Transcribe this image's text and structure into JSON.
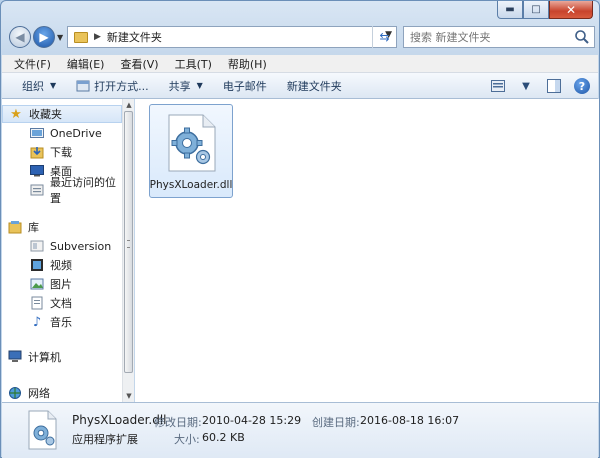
{
  "window": {
    "caption_buttons": {
      "minimize": "▬",
      "maximize": "□",
      "close": "✕"
    }
  },
  "address_bar": {
    "path": "新建文件夹",
    "search_placeholder": "搜索 新建文件夹"
  },
  "menu": [
    "文件(F)",
    "编辑(E)",
    "查看(V)",
    "工具(T)",
    "帮助(H)"
  ],
  "toolbar": {
    "organize": "组织",
    "open_with": "打开方式...",
    "share": "共享",
    "email": "电子邮件",
    "new_folder": "新建文件夹"
  },
  "nav": {
    "favorites": "收藏夹",
    "onedrive": "OneDrive",
    "downloads": "下载",
    "desktop": "桌面",
    "recent": "最近访问的位置",
    "libraries": "库",
    "subversion": "Subversion",
    "videos": "视频",
    "pictures": "图片",
    "documents": "文档",
    "music": "音乐",
    "computer": "计算机",
    "network": "网络"
  },
  "files": [
    {
      "name": "PhysXLoader.dll",
      "icon": "dll-gear-icon"
    }
  ],
  "details": {
    "filename": "PhysXLoader.dll",
    "type": "应用程序扩展",
    "modified_label": "修改日期:",
    "modified_value": "2010-04-28 15:29",
    "created_label": "创建日期:",
    "created_value": "2016-08-18 16:07",
    "size_label": "大小:",
    "size_value": "60.2 KB"
  },
  "colors": {
    "accent": "#1d55a6",
    "selection": "#d9e9fb"
  }
}
